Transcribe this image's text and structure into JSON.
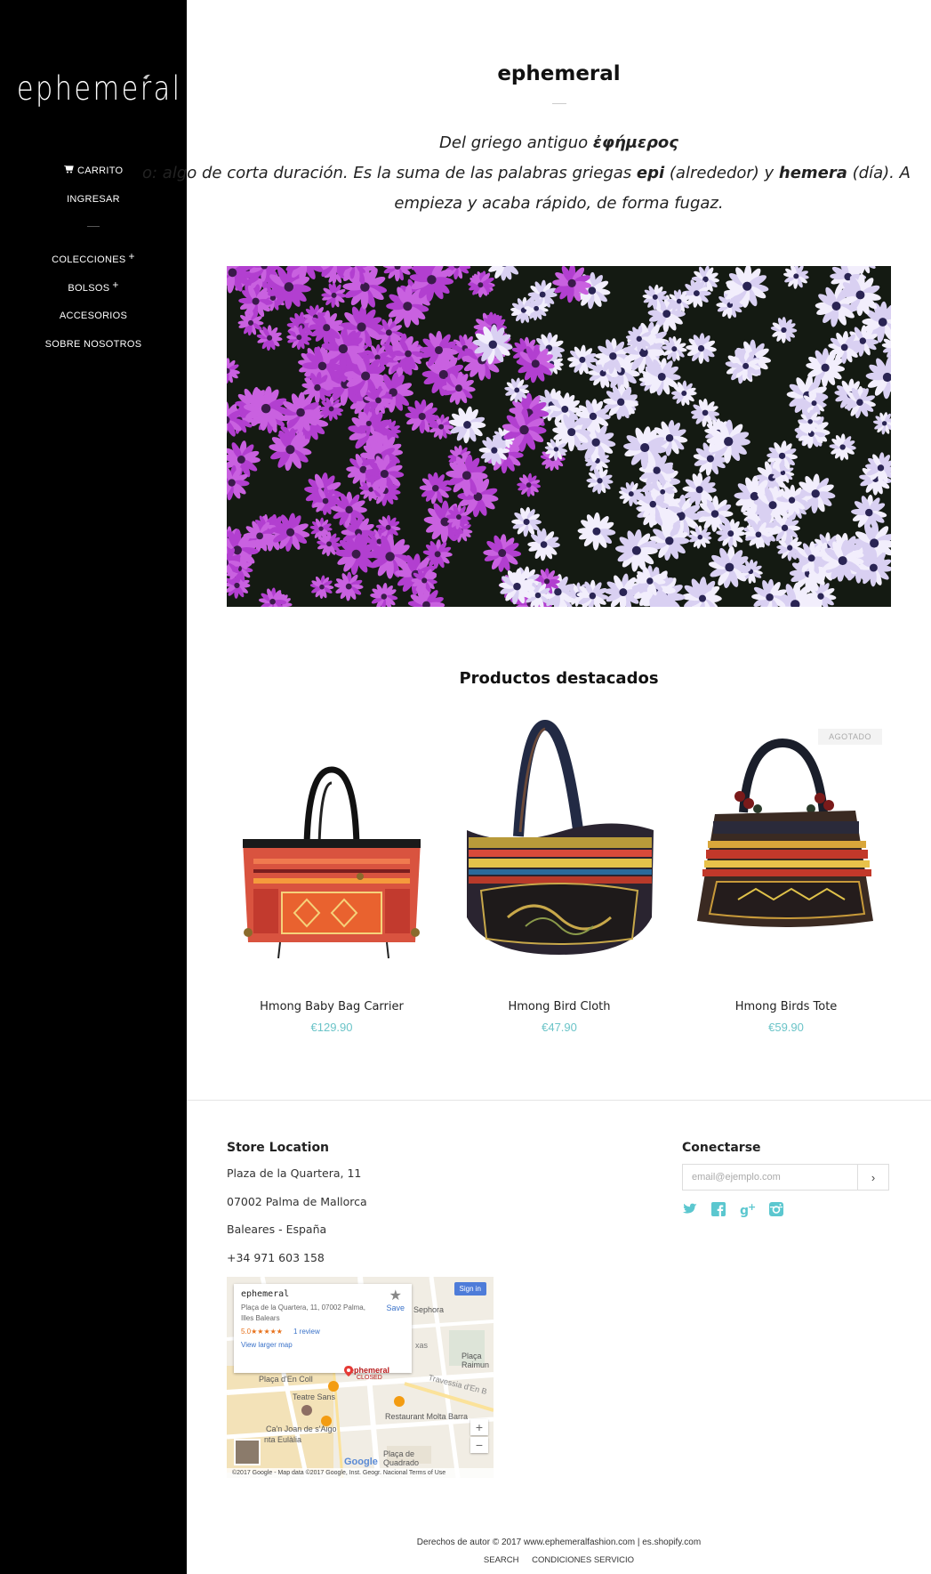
{
  "sidebar": {
    "logo": "ephemeral",
    "nav": {
      "cart": "CARRITO",
      "login": "INGRESAR",
      "collections": "COLECCIONES",
      "bags": "BOLSOS",
      "accessories": "ACCESORIOS",
      "about": "SOBRE NOSOTROS",
      "plus": "+"
    }
  },
  "header": {
    "title": "ephemeral"
  },
  "quote": {
    "line1_prefix": "Del griego antiguo ",
    "line1_greek": "ἐφήμερος",
    "line2_a": "o: algo de corta duración. Es la suma de las palabras griegas ",
    "line2_epi": "epi",
    "line2_b": " (alrededor) y ",
    "line2_hemera": "hemera",
    "line2_c": " (día). A",
    "line3": "empieza y acaba rápido, de forma fugaz."
  },
  "featured": {
    "title": "Productos destacados",
    "products": [
      {
        "name": "Hmong Baby Bag Carrier",
        "price": "€129.90"
      },
      {
        "name": "Hmong Bird Cloth",
        "price": "€47.90"
      },
      {
        "name": "Hmong Birds Tote",
        "price": "€59.90",
        "badge": "AGOTADO"
      }
    ]
  },
  "store": {
    "title": "Store Location",
    "address1": "Plaza de la Quartera, 11",
    "address2": "07002 Palma de Mallorca",
    "address3": "Baleares - España",
    "phone": "+34 971 603 158"
  },
  "map": {
    "place_name": "ephemeral",
    "place_address": "Plaça de la Quartera, 11, 07002 Palma, Illes Balears",
    "rating": "5.0★★★★★",
    "reviews": "1 review",
    "larger_map": "View larger map",
    "save": "Save",
    "signin": "Sign in",
    "marker_name": "ephemeral",
    "marker_status": "CLOSED",
    "labels": {
      "sephora": "Sephora",
      "placa_coll": "Plaça d'En Coll",
      "teatre": "Teatre Sans",
      "canjoan": "Ca'n Joan de s'Aigo",
      "eulalia": "nta Eulàlia",
      "molta": "Restaurant Molta Barra",
      "placa_raimun": "Plaça Raimun",
      "texas": "xas",
      "travessia": "Travessia d'En B",
      "placa_quadrado": "Plaça de Quadrado"
    },
    "zoom_in": "+",
    "zoom_out": "−",
    "google": "Google",
    "footer": "©2017 Google - Map data ©2017 Google, Inst. Geogr. Nacional   Terms of Use"
  },
  "connect": {
    "title": "Conectarse",
    "email_placeholder": "email@ejemplo.com",
    "submit": "›"
  },
  "colors": {
    "accent": "#6bc4c8",
    "social": "#5bc7cf",
    "sidebar": "#000000"
  },
  "social_icons": [
    "twitter-icon",
    "facebook-icon",
    "google-plus-icon",
    "instagram-icon"
  ],
  "footer": {
    "copyright": "Derechos de autor © 2017 www.ephemeralfashion.com | es.shopify.com",
    "search": "SEARCH",
    "terms": "CONDICIONES SERVICIO"
  }
}
